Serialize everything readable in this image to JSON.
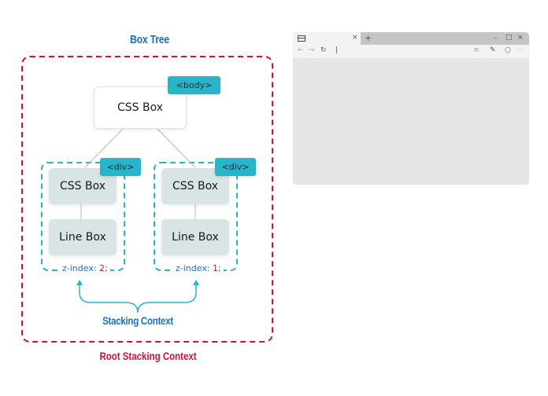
{
  "diagram": {
    "title": "Box Tree",
    "root_label": "Root Stacking Context",
    "stacking_label": "Stacking Context",
    "root_node": {
      "label": "CSS Box",
      "tag": "<body>"
    },
    "children": [
      {
        "tag": "<div>",
        "css_box": "CSS Box",
        "line_box": "Line Box",
        "zindex_prefix": "z-index: ",
        "zindex_value": "2",
        "zindex_suffix": ";"
      },
      {
        "tag": "<div>",
        "css_box": "CSS Box",
        "line_box": "Line Box",
        "zindex_prefix": "z-index: ",
        "zindex_value": "1",
        "zindex_suffix": ";"
      }
    ],
    "colors": {
      "root_border": "#d0103a",
      "context_border": "#27b6c9",
      "title": "#1a6fbf",
      "tag_bg": "#27b6c9"
    }
  },
  "browser": {
    "tab_icon": "tab-icon",
    "close_tab": "×",
    "new_tab": "+",
    "minimize": "–",
    "maximize": "□",
    "close": "×",
    "back": "←",
    "forward": "→",
    "refresh": "↻",
    "cursor": "|",
    "reading": "≡",
    "notes": "✎",
    "hub": "○",
    "more": "···"
  }
}
